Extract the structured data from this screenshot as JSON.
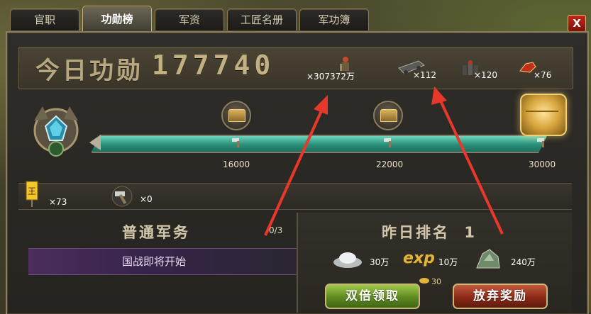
{
  "tabs": [
    {
      "label": "官职"
    },
    {
      "label": "功勋榜"
    },
    {
      "label": "军资"
    },
    {
      "label": "工匠名册"
    },
    {
      "label": "军功簿"
    }
  ],
  "close_label": "X",
  "header": {
    "merit_label": "今日功勋",
    "merit_value": "177740",
    "rewards": [
      {
        "icon": "soldier-icon",
        "count": "×307372万"
      },
      {
        "icon": "supply-cart-icon",
        "count": "×112"
      },
      {
        "icon": "troops-icon",
        "count": "×120"
      },
      {
        "icon": "war-horse-icon",
        "count": "×76"
      }
    ]
  },
  "progress": {
    "milestones": [
      {
        "label": "16000",
        "value": 16000
      },
      {
        "label": "22000",
        "value": 22000
      },
      {
        "label": "30000",
        "value": 30000
      }
    ],
    "fill_fraction": 1.0
  },
  "inventory": [
    {
      "icon": "king-token-icon",
      "count": "×73"
    },
    {
      "icon": "hammer-icon",
      "count": "×0"
    }
  ],
  "tasks": {
    "title": "普通军务",
    "progress": "0/3",
    "item": "国战即将开始"
  },
  "yesterday": {
    "title": "昨日排名",
    "rank": "1",
    "rewards": [
      {
        "icon": "silver-ingot-icon",
        "text": "30万"
      },
      {
        "icon": "exp-icon",
        "label": "exp",
        "text": "10万"
      },
      {
        "icon": "ore-icon",
        "text": "240万"
      }
    ],
    "gold_amount": "30",
    "double_button": "双倍领取",
    "abandon_button": "放弃奖励"
  },
  "colors": {
    "accent_green": "#5d8a21",
    "accent_red": "#8c2a18",
    "progress_teal": "#2a8f78",
    "annotation_arrow": "#e8372b"
  }
}
